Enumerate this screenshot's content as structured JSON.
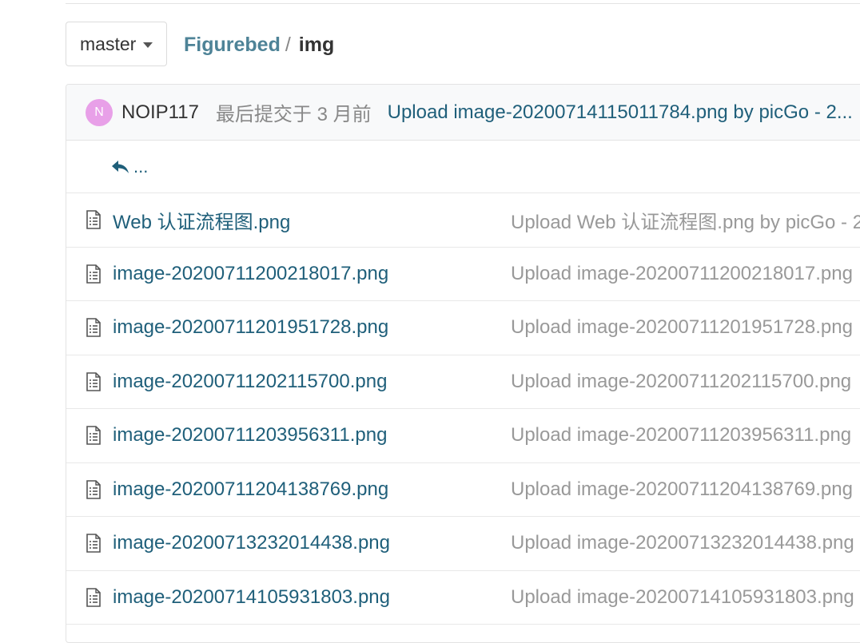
{
  "branch": {
    "label": "master"
  },
  "breadcrumb": {
    "repo": "Figurebed",
    "separator": "/",
    "dir": "img"
  },
  "commit": {
    "avatar_letter": "N",
    "author": "NOIP117",
    "meta": "最后提交于 3 月前",
    "message": "Upload image-20200714115011784.png by picGo - 2..."
  },
  "parent": {
    "label": "..."
  },
  "files": [
    {
      "name": "Web 认证流程图.png",
      "commit": "Upload Web 认证流程图.png by picGo - 2"
    },
    {
      "name": "image-20200711200218017.png",
      "commit": "Upload image-20200711200218017.png"
    },
    {
      "name": "image-20200711201951728.png",
      "commit": "Upload image-20200711201951728.png"
    },
    {
      "name": "image-20200711202115700.png",
      "commit": "Upload image-20200711202115700.png"
    },
    {
      "name": "image-20200711203956311.png",
      "commit": "Upload image-20200711203956311.png"
    },
    {
      "name": "image-20200711204138769.png",
      "commit": "Upload image-20200711204138769.png"
    },
    {
      "name": "image-20200713232014438.png",
      "commit": "Upload image-20200713232014438.png"
    },
    {
      "name": "image-20200714105931803.png",
      "commit": "Upload image-20200714105931803.png"
    }
  ]
}
